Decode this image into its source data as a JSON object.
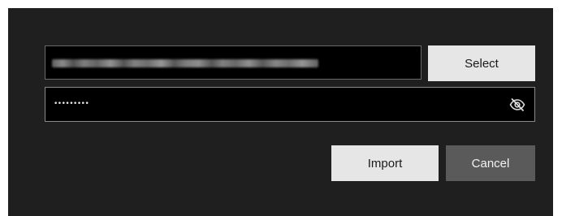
{
  "import_dialog": {
    "file_path": {
      "value": "",
      "obscured": true
    },
    "select_label": "Select",
    "password": {
      "masked_value": "•••••••••",
      "visibility_icon": "eye-off-icon"
    },
    "import_label": "Import",
    "cancel_label": "Cancel"
  },
  "colors": {
    "dialog_background": "#1f1f1f",
    "field_background": "#000000",
    "primary_button": "#e6e6e6",
    "secondary_button": "#5a5a5a"
  }
}
